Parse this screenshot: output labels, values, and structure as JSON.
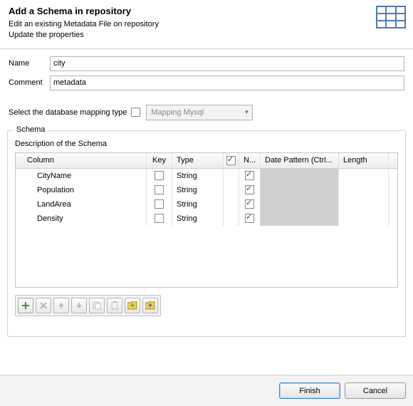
{
  "header": {
    "title": "Add a Schema in repository",
    "line1": "Edit an existing Metadata File on repository",
    "line2": "Update the properties"
  },
  "form": {
    "name_label": "Name",
    "name_value": "city",
    "comment_label": "Comment",
    "comment_value": "metadata"
  },
  "mapping": {
    "label": "Select the database mapping type",
    "checked": false,
    "combo_value": "Mapping Mysql"
  },
  "schema": {
    "legend": "Schema",
    "description": "Description of the Schema",
    "columns": {
      "col": "Column",
      "key": "Key",
      "type": "Type",
      "n": "N...",
      "date": "Date Pattern (Ctrl...",
      "len": "Length"
    },
    "rows": [
      {
        "col": "CityName",
        "key": false,
        "type": "String",
        "n": true,
        "date": "",
        "len": ""
      },
      {
        "col": "Population",
        "key": false,
        "type": "String",
        "n": true,
        "date": "",
        "len": ""
      },
      {
        "col": "LandArea",
        "key": false,
        "type": "String",
        "n": true,
        "date": "",
        "len": ""
      },
      {
        "col": "Density",
        "key": false,
        "type": "String",
        "n": true,
        "date": "",
        "len": ""
      }
    ],
    "n_header_checked": true
  },
  "toolbar": {
    "add": "+",
    "del": "✕",
    "up": "⇧",
    "down": "⇩",
    "copy": "⧉",
    "paste": "⧉",
    "import": "",
    "export": ""
  },
  "footer": {
    "finish": "Finish",
    "cancel": "Cancel"
  }
}
